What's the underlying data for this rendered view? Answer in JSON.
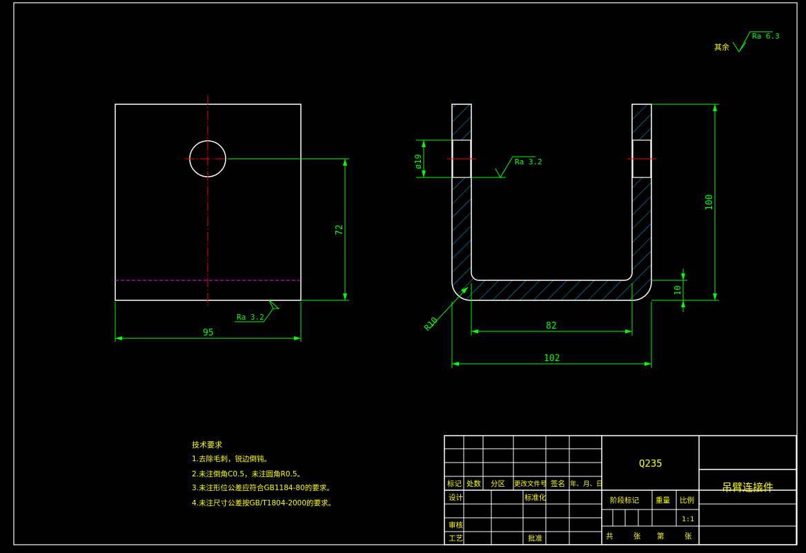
{
  "colors": {
    "background": "#000000",
    "outline": "#ffffff",
    "dimension": "#00ff00",
    "centerline": "#ff0000",
    "hatch": "#00c8ff",
    "hidden": "#ff00ff",
    "title_text": "#ffff00"
  },
  "surface_finish": {
    "general_prefix": "其余",
    "general_value": "Ra 6.3",
    "hole_value": "Ra 3.2",
    "bottom_value": "Ra 3.2"
  },
  "dimensions": {
    "front_width": "95",
    "front_hole_height": "72",
    "hole_diameter": "ø19",
    "total_height": "100",
    "base_thickness": "10",
    "inner_width": "82",
    "outer_width": "102",
    "bend_radius": "R10"
  },
  "tech_requirements": {
    "title": "技术要求",
    "items": [
      "1.去除毛刺，锐边倒钝。",
      "2.未注倒角C0.5，未注圆角R0.5。",
      "3.未注形位公差应符合GB1184-80的要求。",
      "4.未注尺寸公差按GB/T1804-2000的要求。"
    ]
  },
  "title_block": {
    "material": "Q235",
    "part_name": "吊臂连接件",
    "revision_headers": [
      "标记",
      "处数",
      "分区",
      "更改文件号",
      "签名",
      "年、月、日"
    ],
    "design": "设计",
    "standardize": "标准化",
    "review": "审核",
    "process": "工艺",
    "approve": "批准",
    "stage_mark": "阶段标记",
    "weight": "重量",
    "scale": "比例",
    "scale_value": "1:1",
    "sheet_total": "共",
    "sheet_unit_1": "张",
    "sheet_no": "第",
    "sheet_unit_2": "张"
  }
}
